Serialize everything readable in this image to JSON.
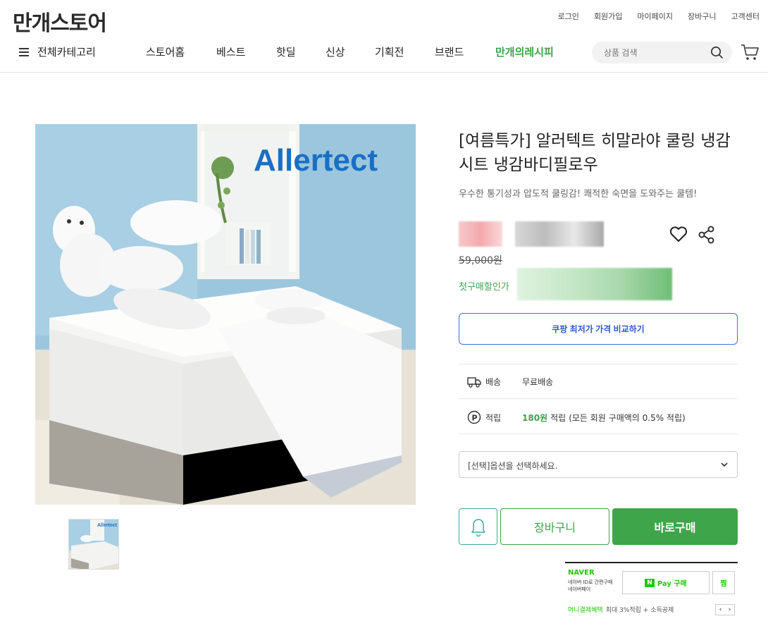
{
  "header": {
    "logo": "만개스토어",
    "util_links": [
      "로그인",
      "회원가입",
      "마이페이지",
      "장바구니",
      "고객센터"
    ],
    "category_menu": "전체카테고리",
    "nav": [
      "스토어홈",
      "베스트",
      "핫딜",
      "신상",
      "기획전",
      "브랜드",
      "만개의레시피"
    ],
    "search_placeholder": "상품 검색"
  },
  "product": {
    "brand_text": "Allertect",
    "title": "[여름특가] 알러텍트 히말라야 쿨링 냉감시트 냉감바디필로우",
    "subtitle": "우수한 통기성과 압도적 쿨링감! 쾌적한 숙면을 도와주는 쿨템!",
    "original_price": "59,000원",
    "first_purchase_label": "첫구매할인가",
    "compare_button": "쿠팡 최저가 가격 비교하기",
    "shipping": {
      "label": "배송",
      "value": "무료배송"
    },
    "points": {
      "label": "적립",
      "amount": "180원",
      "suffix": "적립",
      "note": "(모든 회원 구매액의 0.5% 적립)"
    },
    "option_select": "[선택]옵션을 선택하세요.",
    "cart_button": "장바구니",
    "buy_button": "바로구매"
  },
  "npay": {
    "brand": "NAVER",
    "desc": "네이버 ID로 간편구매\n네이버페이",
    "button": "Pay 구매",
    "button_n": "N",
    "jjim": "찜",
    "benefit_label": "머니결제혜택",
    "benefit_text": "최대 3%적립 + 소득공제",
    "pager_prev": "‹",
    "pager_next": "›"
  },
  "colors": {
    "accent_green": "#3fa54a",
    "compare_blue": "#2a5bd0"
  }
}
